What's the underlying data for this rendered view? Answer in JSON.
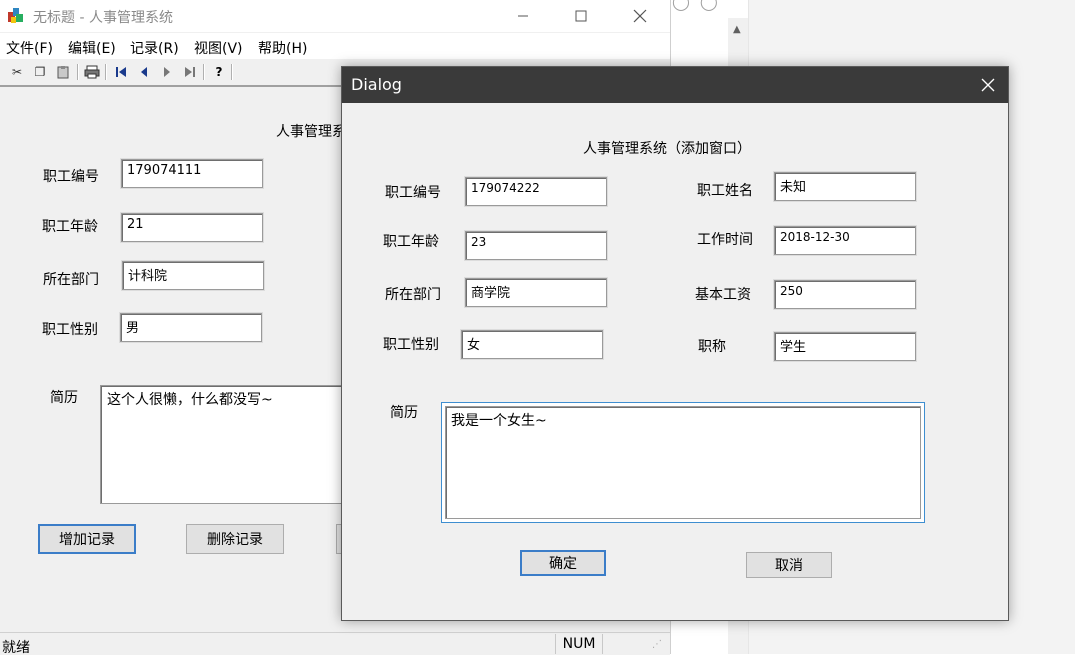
{
  "main": {
    "title": "无标题 - 人事管理系统",
    "menu": [
      "文件(F)",
      "编辑(E)",
      "记录(R)",
      "视图(V)",
      "帮助(H)"
    ],
    "heading": "人事管理系",
    "labels": {
      "id": "职工编号",
      "age": "职工年龄",
      "dept": "所在部门",
      "gender": "职工性别",
      "resume": "简历"
    },
    "values": {
      "id": "179074111",
      "age": "21",
      "dept": "计科院",
      "gender": "男",
      "resume": "这个人很懒，什么都没写~"
    },
    "buttons": {
      "add": "增加记录",
      "delete": "删除记录"
    },
    "status": {
      "text": "就绪",
      "num": "NUM"
    }
  },
  "dialog": {
    "title": "Dialog",
    "heading": "人事管理系统（添加窗口）",
    "labels": {
      "id": "职工编号",
      "name": "职工姓名",
      "age": "职工年龄",
      "work_time": "工作时间",
      "dept": "所在部门",
      "salary": "基本工资",
      "gender": "职工性别",
      "job_title": "职称",
      "resume": "简历"
    },
    "values": {
      "id": "179074222",
      "name": "未知",
      "age": "23",
      "work_time": "2018-12-30",
      "dept": "商学院",
      "salary": "250",
      "gender": "女",
      "job_title": "学生",
      "resume": "我是一个女生~"
    },
    "buttons": {
      "ok": "确定",
      "cancel": "取消"
    }
  },
  "icons": [
    "app-icon",
    "cut-icon",
    "copy-icon",
    "paste-icon",
    "print-icon",
    "first-record-icon",
    "prev-record-icon",
    "next-record-icon",
    "last-record-icon",
    "help-icon",
    "minimize-icon",
    "maximize-icon",
    "close-icon"
  ]
}
